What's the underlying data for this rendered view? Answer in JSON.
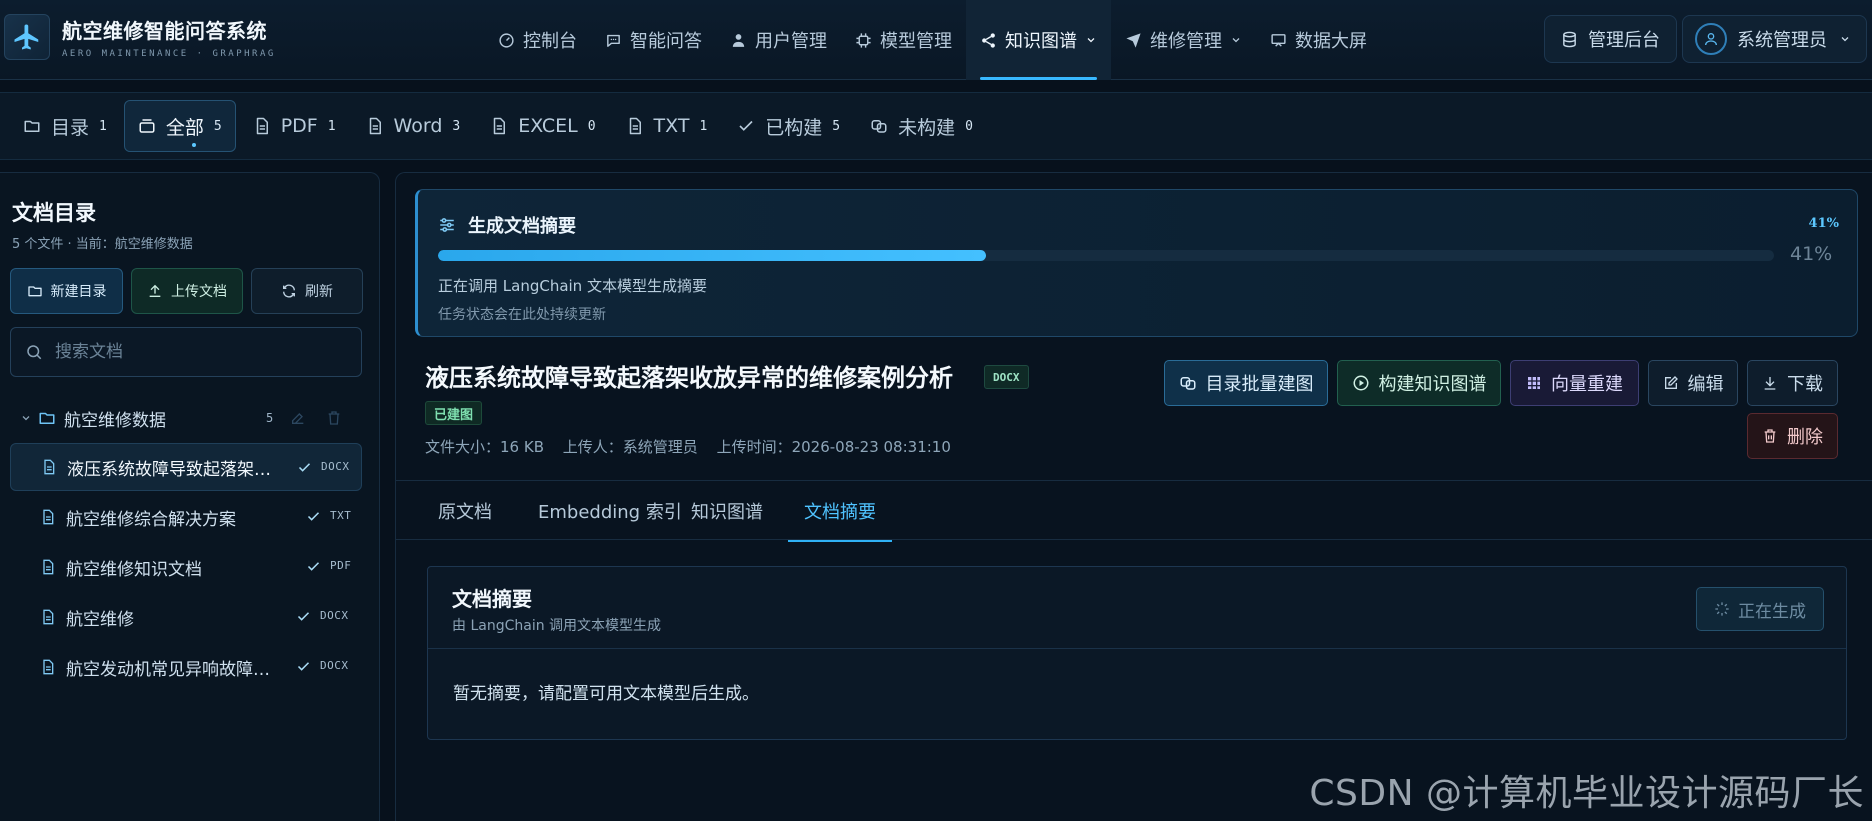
{
  "brand": {
    "title": "航空维修智能问答系统",
    "subtitle": "AERO MAINTENANCE · GRAPHRAG"
  },
  "nav": {
    "items": [
      {
        "label": "控制台",
        "icon": "gauge-icon"
      },
      {
        "label": "智能问答",
        "icon": "chat-icon"
      },
      {
        "label": "用户管理",
        "icon": "user-icon"
      },
      {
        "label": "模型管理",
        "icon": "chip-icon"
      },
      {
        "label": "知识图谱",
        "icon": "share-icon",
        "active": true,
        "dropdown": true
      },
      {
        "label": "维修管理",
        "icon": "send-icon",
        "dropdown": true
      },
      {
        "label": "数据大屏",
        "icon": "screen-icon"
      }
    ],
    "admin_label": "管理后台",
    "user_label": "系统管理员"
  },
  "filters": [
    {
      "label": "目录",
      "count": "1"
    },
    {
      "label": "全部",
      "count": "5",
      "active": true
    },
    {
      "label": "PDF",
      "count": "1"
    },
    {
      "label": "Word",
      "count": "3"
    },
    {
      "label": "EXCEL",
      "count": "0"
    },
    {
      "label": "TXT",
      "count": "1"
    },
    {
      "label": "已构建",
      "count": "5"
    },
    {
      "label": "未构建",
      "count": "0"
    }
  ],
  "sidebar": {
    "title": "文档目录",
    "subtitle": "5 个文件 · 当前：航空维修数据",
    "new_folder": "新建目录",
    "upload": "上传文档",
    "refresh": "刷新",
    "search_placeholder": "搜索文档",
    "folder": {
      "name": "航空维修数据",
      "count": "5"
    },
    "files": [
      {
        "name": "液压系统故障导致起落架收放异常的维修案例分析",
        "ext": "DOCX",
        "active": true
      },
      {
        "name": "航空维修综合解决方案",
        "ext": "TXT"
      },
      {
        "name": "航空维修知识文档",
        "ext": "PDF"
      },
      {
        "name": "航空维修",
        "ext": "DOCX"
      },
      {
        "name": "航空发动机常见异响故障诊断与排除",
        "ext": "DOCX"
      }
    ]
  },
  "progress": {
    "title": "生成文档摘要",
    "percent": 41,
    "percent_label": "41%",
    "message": "正在调用 LangChain 文本模型生成摘要",
    "hint": "任务状态会在此处持续更新"
  },
  "document": {
    "title": "液压系统故障导致起落架收放异常的维修案例分析",
    "type": "DOCX",
    "status": "已建图",
    "size": "文件大小：16 KB",
    "uploader": "上传人：系统管理员",
    "uploaded": "上传时间：2026-08-23 08:31:10"
  },
  "actions": {
    "batch": "目录批量建图",
    "build": "构建知识图谱",
    "vector": "向量重建",
    "edit": "编辑",
    "download": "下载",
    "delete": "删除"
  },
  "doc_tabs": [
    {
      "label": "原文档"
    },
    {
      "label": "Embedding 索引"
    },
    {
      "label": "知识图谱"
    },
    {
      "label": "文档摘要",
      "active": true
    }
  ],
  "summary": {
    "title": "文档摘要",
    "subtitle": "由 LangChain 调用文本模型生成",
    "button": "正在生成",
    "body": "暂无摘要，请配置可用文本模型后生成。"
  },
  "watermark": "CSDN @计算机毕业设计源码厂长",
  "colors": {
    "accent": "#38b8ff",
    "success": "#7fe0b0",
    "danger": "#f2c9cb",
    "background": "#07111c"
  }
}
